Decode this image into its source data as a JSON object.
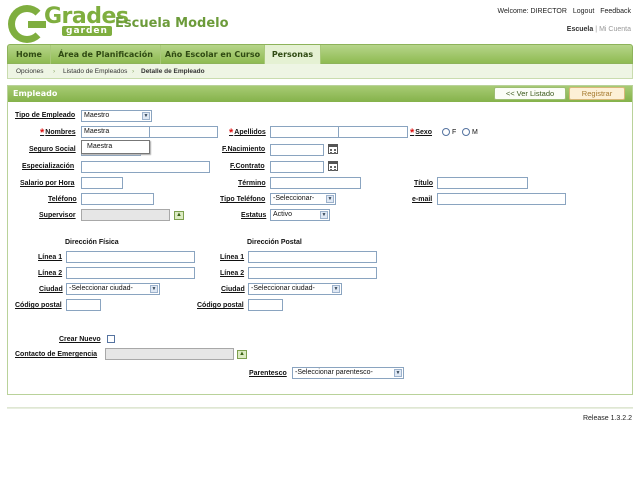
{
  "brand": {
    "logo_main": "Grades",
    "logo_sub": "garden",
    "school_name": "Escuela Modelo"
  },
  "top": {
    "welcome": "Welcome: DIRECTOR",
    "logout": "Logout",
    "feedback": "Feedback",
    "school_current": "Escuela",
    "school_sep": "|",
    "school_other": "Mi Cuenta"
  },
  "nav": {
    "tabs": [
      "Home",
      "Área de Planificación",
      "Año Escolar en Curso",
      "Personas"
    ],
    "active": "Personas"
  },
  "breadcrumb": {
    "items": [
      "Opciones",
      "Listado de Empleados",
      "Detalle de Empleado"
    ]
  },
  "panel": {
    "title": "Empleado",
    "btn_back": "<< Ver Listado",
    "btn_register": "Registrar"
  },
  "form": {
    "tipo_empleado_label": "Tipo de Empleado",
    "tipo_empleado_value": "Maestro",
    "nombres_label": "Nombres",
    "nombres_value": "Maestra",
    "apellidos_label": "Apellidos",
    "sexo_label": "Sexo",
    "sexo_f": "F",
    "sexo_m": "M",
    "seguro_social_label": "Seguro Social",
    "f_nacimiento_label": "F.Nacimiento",
    "especializacion_label": "Especialización",
    "f_contrato_label": "F.Contrato",
    "salario_label": "Salario por Hora",
    "termino_label": "Término",
    "titulo_label": "Título",
    "telefono_label": "Teléfono",
    "tipo_telefono_label": "Tipo Teléfono",
    "tipo_telefono_value": "-Seleccionar-",
    "email_label": "e-mail",
    "supervisor_label": "Supervisor",
    "estatus_label": "Estatus",
    "estatus_value": "Activo",
    "autocomplete_option": "Maestra"
  },
  "direccion": {
    "fisica_title": "Dirección Física",
    "postal_title": "Dirección Postal",
    "linea1_label": "Línea 1",
    "linea2_label": "Línea 2",
    "ciudad_label": "Ciudad",
    "ciudad_value": "-Seleccionar ciudad-",
    "codigo_postal_label": "Código postal"
  },
  "emergencia": {
    "crear_nuevo_label": "Crear Nuevo",
    "contacto_label": "Contacto de Emergencia",
    "parentesco_label": "Parentesco",
    "parentesco_value": "-Seleccionar parentesco-"
  },
  "footer": {
    "release": "Release 1.3.2.2"
  },
  "colors": {
    "brand_green": "#7fae3f",
    "nav_green": "#8fbb52",
    "required_red": "#dd1111"
  }
}
